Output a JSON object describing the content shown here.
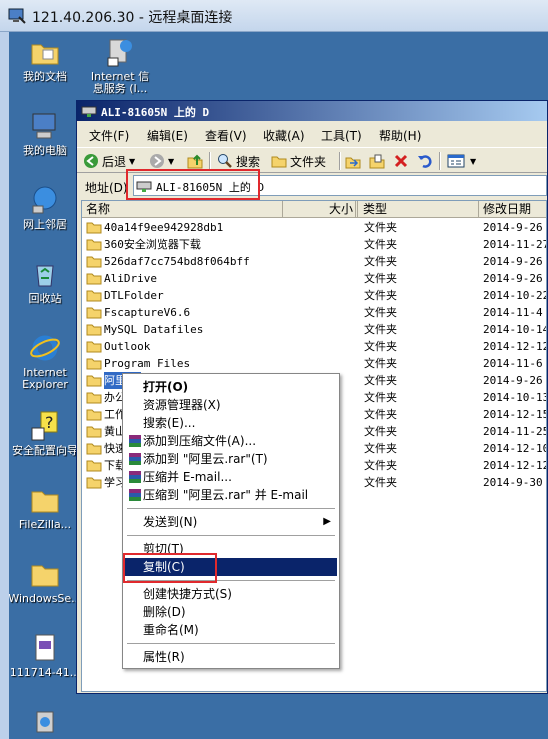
{
  "rdp": {
    "title": "121.40.206.30 - 远程桌面连接"
  },
  "desktop": {
    "icons": [
      {
        "label": "我的文档",
        "icon": "my-documents-icon"
      },
      {
        "label": "Internet 信",
        "label2": "息服务 (I...",
        "icon": "iis-icon"
      },
      {
        "label": "我的电脑",
        "icon": "my-computer-icon"
      },
      {
        "label": "网上邻居",
        "icon": "network-places-icon"
      },
      {
        "label": "回收站",
        "icon": "recycle-bin-icon"
      },
      {
        "label": "Internet",
        "label2": "Explorer",
        "icon": "internet-explorer-icon"
      },
      {
        "label": "安全配置向导",
        "icon": "security-wizard-icon"
      },
      {
        "label": "FileZilla...",
        "icon": "folder-icon"
      },
      {
        "label": "WindowsSe...",
        "icon": "folder-icon"
      },
      {
        "label": "111714-41...",
        "icon": "document-icon"
      }
    ]
  },
  "explorer": {
    "title": "ALI-81605N 上的 D",
    "menu": [
      "文件(F)",
      "编辑(E)",
      "查看(V)",
      "收藏(A)",
      "工具(T)",
      "帮助(H)"
    ],
    "toolbar": {
      "back": "后退",
      "search": "搜索",
      "folders": "文件夹"
    },
    "address": {
      "label": "地址(D)",
      "value": "ALI-81605N 上的 D"
    },
    "columns": {
      "name": "名称",
      "size": "大小",
      "type": "类型",
      "modified": "修改日期"
    },
    "rows": [
      {
        "name": "40a14f9ee942928db1",
        "type": "文件夹",
        "date": "2014-9-26 1"
      },
      {
        "name": "360安全浏览器下载",
        "type": "文件夹",
        "date": "2014-11-27"
      },
      {
        "name": "526daf7cc754bd8f064bff",
        "type": "文件夹",
        "date": "2014-9-26 1"
      },
      {
        "name": "AliDrive",
        "type": "文件夹",
        "date": "2014-9-26 1"
      },
      {
        "name": "DTLFolder",
        "type": "文件夹",
        "date": "2014-10-22"
      },
      {
        "name": "FscaptureV6.6",
        "type": "文件夹",
        "date": "2014-11-4 9"
      },
      {
        "name": "MySQL Datafiles",
        "type": "文件夹",
        "date": "2014-10-14"
      },
      {
        "name": "Outlook",
        "type": "文件夹",
        "date": "2014-12-12"
      },
      {
        "name": "Program Files",
        "type": "文件夹",
        "date": "2014-11-6 1"
      },
      {
        "name": "阿里云",
        "type": "文件夹",
        "date": "2014-9-26 1"
      },
      {
        "name": "办公",
        "type": "文件夹",
        "date": "2014-10-13"
      },
      {
        "name": "工作",
        "type": "文件夹",
        "date": "2014-12-15"
      },
      {
        "name": "黄山",
        "type": "文件夹",
        "date": "2014-11-25"
      },
      {
        "name": "快速",
        "type": "文件夹",
        "date": "2014-12-10"
      },
      {
        "name": "下载",
        "type": "文件夹",
        "date": "2014-12-12"
      },
      {
        "name": "学习",
        "type": "文件夹",
        "date": "2014-9-30 1"
      }
    ]
  },
  "context_menu": {
    "open": "打开(O)",
    "explore": "资源管理器(X)",
    "search": "搜索(E)...",
    "add_archive": "添加到压缩文件(A)...",
    "add_rar": "添加到 \"阿里云.rar\"(T)",
    "compress_email": "压缩并 E-mail...",
    "compress_rar_email": "压缩到 \"阿里云.rar\" 并 E-mail",
    "send_to": "发送到(N)",
    "cut": "剪切(T)",
    "copy": "复制(C)",
    "shortcut": "创建快捷方式(S)",
    "delete": "删除(D)",
    "rename": "重命名(M)",
    "properties": "属性(R)"
  },
  "colors": {
    "highlight_box": "#e0292d",
    "selection": "#0a246a",
    "desktop": "#3a6ea5"
  }
}
